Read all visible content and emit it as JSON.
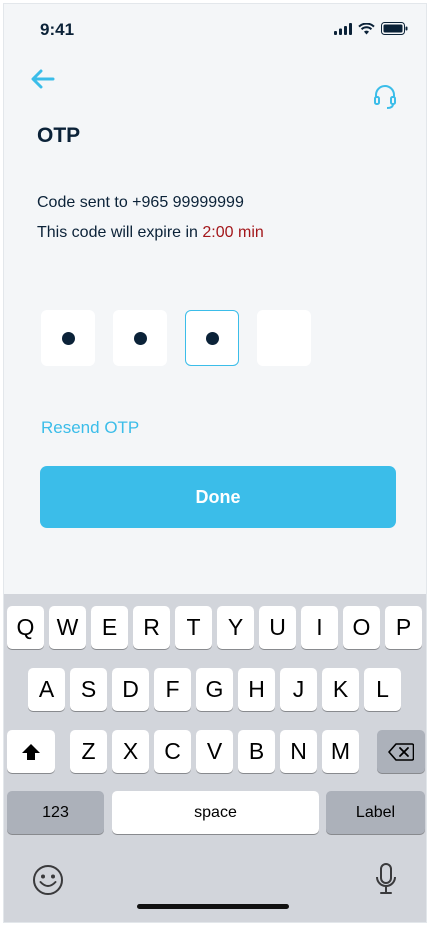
{
  "status_bar": {
    "time": "9:41"
  },
  "header": {
    "title": "OTP"
  },
  "info": {
    "sent_prefix": "Code sent to ",
    "phone": "+965 99999999",
    "expire_prefix": "This code will expire in ",
    "expire_time": "2:00 min"
  },
  "otp": {
    "length": 4,
    "filled": 3,
    "active_index": 2
  },
  "resend_label": "Resend OTP",
  "done_label": "Done",
  "keyboard": {
    "row1": [
      "Q",
      "W",
      "E",
      "R",
      "T",
      "Y",
      "U",
      "I",
      "O",
      "P"
    ],
    "row2": [
      "A",
      "S",
      "D",
      "F",
      "G",
      "H",
      "J",
      "K",
      "L"
    ],
    "row3": [
      "Z",
      "X",
      "C",
      "V",
      "B",
      "N",
      "M"
    ],
    "numbers_label": "123",
    "space_label": "space",
    "return_label": "Label"
  },
  "colors": {
    "accent": "#3bbde9",
    "text": "#0b2238",
    "expiry": "#a3171b"
  }
}
